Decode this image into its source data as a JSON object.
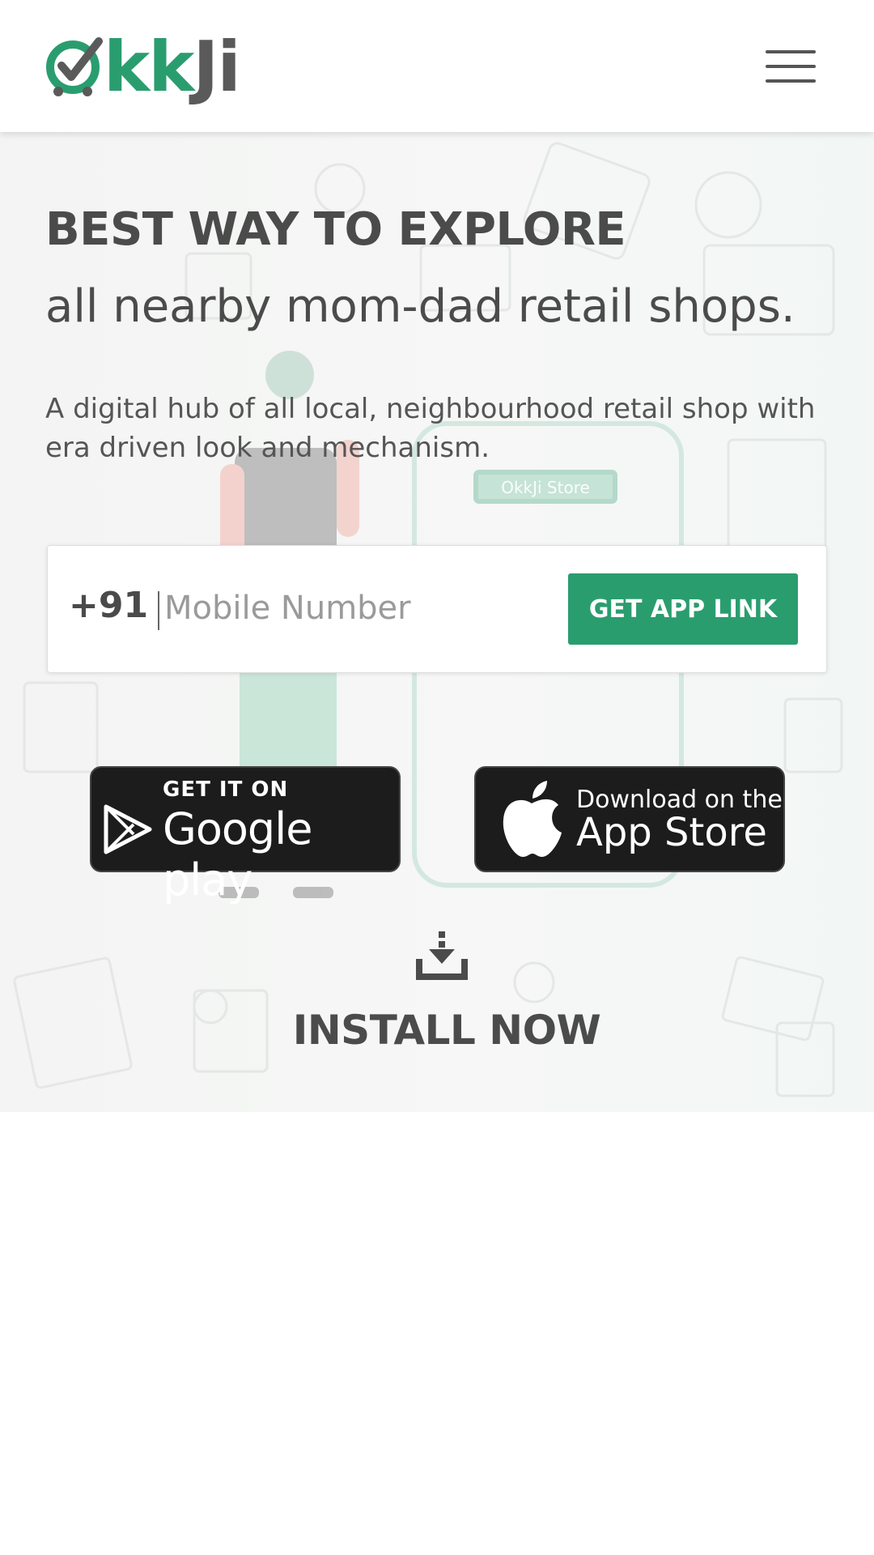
{
  "brand": {
    "logo_kk": "kk",
    "logo_ji": "Ji",
    "primary_color": "#2a9d6f"
  },
  "header": {
    "menu_icon": "hamburger-menu-icon"
  },
  "hero": {
    "headline": "BEST WAY TO EXPLORE",
    "subheadline": "all nearby mom-dad retail shops.",
    "description": "A digital hub of all local, neighbourhood retail shop with era driven look and mechanism.",
    "store_sign": "OkkJi Store"
  },
  "signup": {
    "country_code": "+91",
    "placeholder": "Mobile Number",
    "value": "",
    "button_label": "GET APP LINK"
  },
  "stores": {
    "google": {
      "small": "GET IT ON",
      "big": "Google play",
      "icon": "google-play-icon"
    },
    "apple": {
      "small": "Download on the",
      "big": "App Store",
      "icon": "apple-icon"
    }
  },
  "install": {
    "label": "INSTALL NOW",
    "icon": "download-icon"
  }
}
